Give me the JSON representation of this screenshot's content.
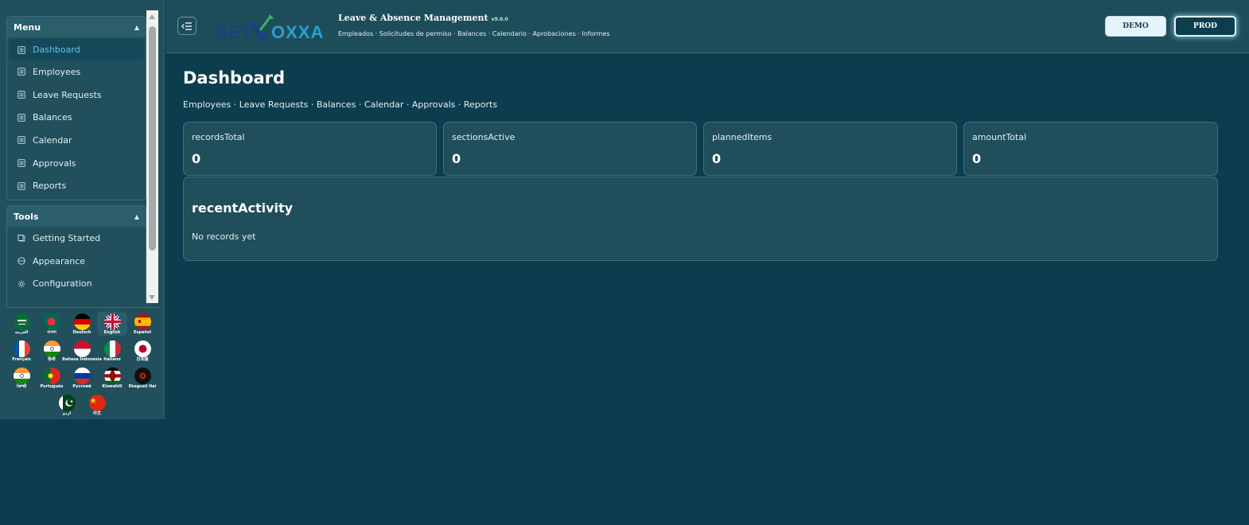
{
  "sidebar": {
    "menu": {
      "title": "Menu",
      "items": [
        {
          "label": "Dashboard",
          "active": true
        },
        {
          "label": "Employees"
        },
        {
          "label": "Leave Requests"
        },
        {
          "label": "Balances"
        },
        {
          "label": "Calendar"
        },
        {
          "label": "Approvals"
        },
        {
          "label": "Reports"
        }
      ]
    },
    "tools": {
      "title": "Tools",
      "items": [
        {
          "label": "Getting Started",
          "icon": "book-icon"
        },
        {
          "label": "Appearance",
          "icon": "palette-icon"
        },
        {
          "label": "Configuration",
          "icon": "gear-icon"
        }
      ]
    },
    "languages": [
      {
        "label": "العربية",
        "flag": "saudi-arabia"
      },
      {
        "label": "বাংলা",
        "flag": "bangladesh"
      },
      {
        "label": "Deutsch",
        "flag": "germany"
      },
      {
        "label": "English",
        "flag": "united-kingdom",
        "selected": true
      },
      {
        "label": "Español",
        "flag": "spain"
      },
      {
        "label": "Français",
        "flag": "france"
      },
      {
        "label": "हिन्दी",
        "flag": "india"
      },
      {
        "label": "Bahasa Indonesia",
        "flag": "indonesia"
      },
      {
        "label": "Italiano",
        "flag": "italy"
      },
      {
        "label": "日本語",
        "flag": "japan"
      },
      {
        "label": "ਪੰਜਾਬੀ",
        "flag": "india"
      },
      {
        "label": "Português",
        "flag": "portugal"
      },
      {
        "label": "Русский",
        "flag": "russia"
      },
      {
        "label": "Kiswahili",
        "flag": "kenya"
      },
      {
        "label": "Ekegusii Hai",
        "flag": "ekegusii"
      },
      {
        "label": "اردو",
        "flag": "pakistan"
      },
      {
        "label": "中文",
        "flag": "china"
      }
    ]
  },
  "header": {
    "logo_text": "GETVOXXA",
    "title": "Leave & Absence Management",
    "version": "v9.0.0",
    "subnav": "Empleados · Solicitudes de permiso · Balances · Calendario · Aprobaciones · Informes",
    "demo_label": "DEMO",
    "prod_label": "PROD"
  },
  "main": {
    "title": "Dashboard",
    "breadcrumb": "Employees · Leave Requests · Balances · Calendar · Approvals · Reports",
    "stats": [
      {
        "label": "recordsTotal",
        "value": "0"
      },
      {
        "label": "sectionsActive",
        "value": "0"
      },
      {
        "label": "plannedItems",
        "value": "0"
      },
      {
        "label": "amountTotal",
        "value": "0"
      }
    ],
    "activity": {
      "title": "recentActivity",
      "empty_text": "No records yet"
    }
  },
  "colors": {
    "background": "#0c3d4e",
    "panel": "#214f5c",
    "accent": "#5fc4e8"
  }
}
